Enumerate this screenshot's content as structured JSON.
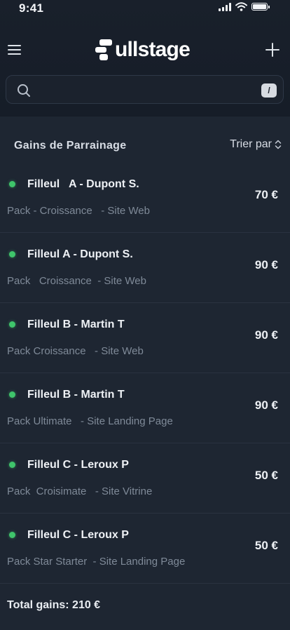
{
  "status_bar": {
    "time": "9:41"
  },
  "header": {
    "brand": "ullstage",
    "search_placeholder": "",
    "search_shortcut": "/"
  },
  "panel": {
    "title": "Gains de Parrainage",
    "sort_label": "Trier par"
  },
  "referrals": [
    {
      "name": "Filleul   A - Dupont S.",
      "description": "Pack - Croissance   - Site Web",
      "amount": "70 €",
      "status_color": "#3fc56b"
    },
    {
      "name": "Filleul A - Dupont S.",
      "description": "Pack   Croissance  - Site Web",
      "amount": "90 €",
      "status_color": "#3fc56b"
    },
    {
      "name": "Filleul B - Martin T",
      "description": "Pack Croissance   - Site Web",
      "amount": "90 €",
      "status_color": "#3fc56b"
    },
    {
      "name": "Filleul B - Martin T",
      "description": "Pack Ultimate   - Site Landing Page",
      "amount": "90 €",
      "status_color": "#3fc56b"
    },
    {
      "name": "Filleul C - Leroux P",
      "description": "Pack  Croisimate   - Site Vitrine",
      "amount": "50 €",
      "status_color": "#3fc56b"
    },
    {
      "name": "Filleul C - Leroux P",
      "description": "Pack Star Starter  - Site Landing Page",
      "amount": "50 €",
      "status_color": "#3fc56b"
    }
  ],
  "total": "Total gains: 210 €",
  "colors": {
    "background": "#151b25",
    "panel": "#1e2632",
    "active_dot": "#3fc56b"
  },
  "icons": [
    "menu-icon",
    "logo-mark-icon",
    "plus-icon",
    "search-icon",
    "sort-icon",
    "status-dot-icon",
    "signal-icon",
    "wifi-icon",
    "battery-icon"
  ]
}
